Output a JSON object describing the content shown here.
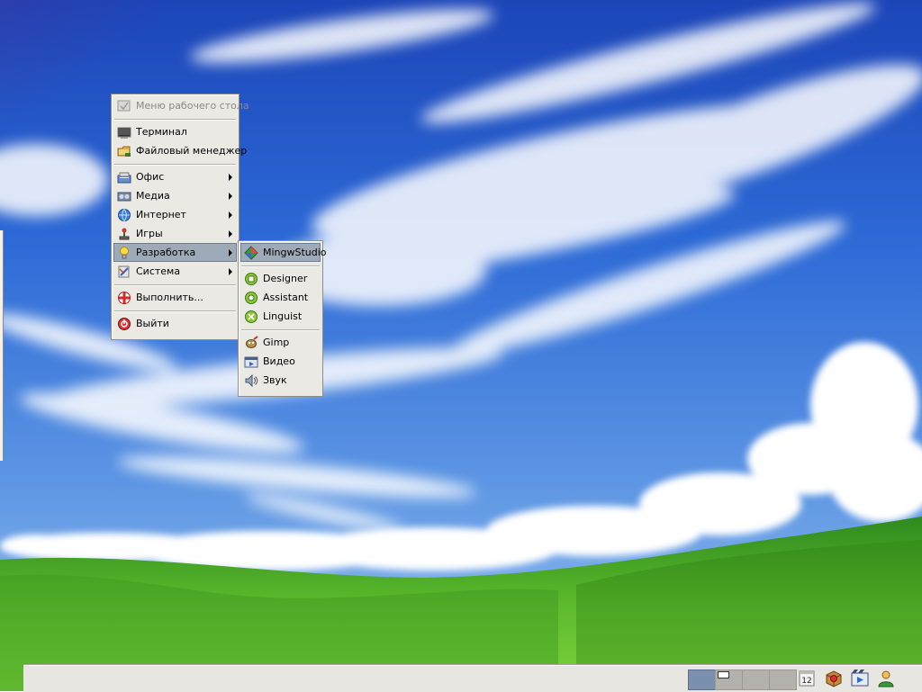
{
  "desktop_menu": {
    "title": "Меню рабочего стола",
    "items": [
      {
        "label": "Терминал",
        "icon": "terminal-icon"
      },
      {
        "label": "Файловый менеджер",
        "icon": "file-manager-icon"
      },
      {
        "label": "Офис",
        "icon": "office-icon",
        "submenu": true
      },
      {
        "label": "Медиа",
        "icon": "media-icon",
        "submenu": true
      },
      {
        "label": "Интернет",
        "icon": "internet-icon",
        "submenu": true
      },
      {
        "label": "Игры",
        "icon": "games-icon",
        "submenu": true
      },
      {
        "label": "Разработка",
        "icon": "development-icon",
        "submenu": true,
        "active": true
      },
      {
        "label": "Система",
        "icon": "system-icon",
        "submenu": true
      },
      {
        "label": "Выполнить...",
        "icon": "run-icon"
      },
      {
        "label": "Выйти",
        "icon": "logout-icon"
      }
    ]
  },
  "dev_submenu": {
    "items": [
      {
        "label": "MingwStudio",
        "icon": "mingwstudio-icon"
      },
      {
        "label": "Designer",
        "icon": "designer-icon"
      },
      {
        "label": "Assistant",
        "icon": "assistant-icon"
      },
      {
        "label": "Linguist",
        "icon": "linguist-icon"
      },
      {
        "label": "Gimp",
        "icon": "gimp-icon"
      },
      {
        "label": "Видео",
        "icon": "video-icon"
      },
      {
        "label": "Звук",
        "icon": "sound-icon"
      }
    ]
  },
  "taskbar": {
    "workspaces": [
      {
        "name": "workspace-1",
        "active": true
      },
      {
        "name": "workspace-2",
        "active": false
      },
      {
        "name": "workspace-3",
        "active": false
      },
      {
        "name": "workspace-4",
        "active": false
      }
    ],
    "calendar_day": "12",
    "tray_icons": [
      "calendar-icon",
      "package-icon",
      "video-player-icon",
      "user-icon"
    ]
  },
  "colors": {
    "menu_bg": "#ebe9e3",
    "menu_active": "#9eaab8",
    "workspace_active": "#7b8fae",
    "sky_top": "#1e4fc0",
    "grass": "#4ca82a"
  }
}
